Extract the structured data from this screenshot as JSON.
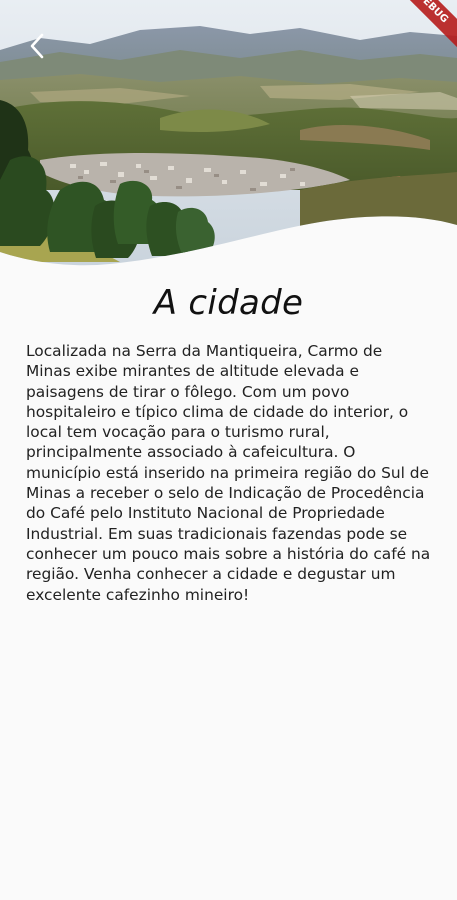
{
  "header": {
    "back_icon": "chevron-left-icon",
    "debug_banner": "DEBUG"
  },
  "content": {
    "title": "A cidade",
    "body": "Localizada na Serra da Mantiqueira, Carmo de Minas exibe mirantes de altitude elevada e paisagens de tirar o fôlego. Com um povo hospitaleiro e típico clima de cidade do interior, o local tem vocação para o turismo rural, principalmente associado à cafeicultura. O município está inserido na primeira região do Sul de Minas a receber o selo de Indicação de Procedência do Café pelo Instituto Nacional de Propriedade Industrial. Em suas tradicionais fazendas pode se conhecer um pouco mais sobre a história do café na região. Venha conhecer a cidade e degustar um excelente cafezinho mineiro!"
  },
  "colors": {
    "background": "#fafafa",
    "debug_banner": "#b71c1c",
    "text": "#222222"
  }
}
